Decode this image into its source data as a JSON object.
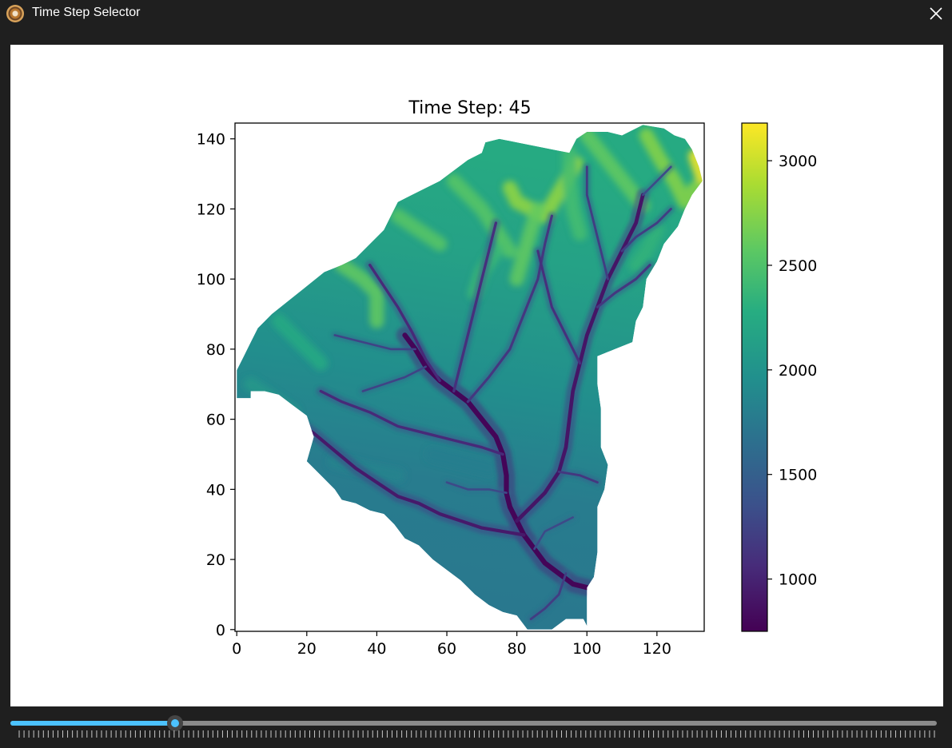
{
  "window": {
    "title": "Time Step Selector",
    "icon": "app-logo-icon",
    "close_icon": "close-icon"
  },
  "colors": {
    "window_bg": "#1f1f1f",
    "panel_bg": "#ffffff",
    "accent": "#4cc2ff",
    "slider_rail": "#8a8a8a"
  },
  "slider": {
    "value_fraction": 0.178,
    "tick_count": 190
  },
  "chart_data": {
    "type": "heatmap",
    "title": "Time Step: 45",
    "colormap": "viridis",
    "x": {
      "range": [
        -0.5,
        133.5
      ],
      "ticks": [
        0,
        20,
        40,
        60,
        80,
        100,
        120
      ]
    },
    "y": {
      "range": [
        -0.5,
        144.5
      ],
      "ticks": [
        0,
        20,
        40,
        60,
        80,
        100,
        120,
        140
      ]
    },
    "colorbar": {
      "range": [
        750,
        3180
      ],
      "ticks": [
        1000,
        1500,
        2000,
        2500,
        3000
      ]
    },
    "watershed_outline": [
      [
        0,
        66
      ],
      [
        4,
        66
      ],
      [
        4,
        68
      ],
      [
        8,
        68
      ],
      [
        12,
        67
      ],
      [
        16,
        64
      ],
      [
        20,
        61
      ],
      [
        22,
        55
      ],
      [
        20,
        48
      ],
      [
        24,
        44
      ],
      [
        28,
        40
      ],
      [
        30,
        37
      ],
      [
        34,
        36
      ],
      [
        38,
        34
      ],
      [
        42,
        33
      ],
      [
        45,
        30
      ],
      [
        48,
        26
      ],
      [
        52,
        24
      ],
      [
        56,
        20
      ],
      [
        60,
        17
      ],
      [
        64,
        14
      ],
      [
        68,
        10
      ],
      [
        72,
        7
      ],
      [
        76,
        5
      ],
      [
        80,
        4
      ],
      [
        83,
        0
      ],
      [
        90,
        0
      ],
      [
        94,
        3
      ],
      [
        99,
        3
      ],
      [
        100,
        1
      ],
      [
        100,
        12
      ],
      [
        102,
        15
      ],
      [
        103,
        22
      ],
      [
        103,
        35
      ],
      [
        105,
        40
      ],
      [
        106,
        47
      ],
      [
        104,
        52
      ],
      [
        104,
        63
      ],
      [
        103,
        70
      ],
      [
        103,
        78
      ],
      [
        108,
        80
      ],
      [
        113,
        82
      ],
      [
        114,
        88
      ],
      [
        116,
        92
      ],
      [
        117,
        100
      ],
      [
        120,
        105
      ],
      [
        122,
        110
      ],
      [
        126,
        115
      ],
      [
        128,
        120
      ],
      [
        130,
        124
      ],
      [
        133,
        128
      ],
      [
        132,
        132
      ],
      [
        130,
        137
      ],
      [
        128,
        140
      ],
      [
        125,
        141
      ],
      [
        122,
        143
      ],
      [
        116,
        144
      ],
      [
        110,
        141
      ],
      [
        106,
        142
      ],
      [
        100,
        142
      ],
      [
        97,
        140
      ],
      [
        95,
        136
      ],
      [
        90,
        137
      ],
      [
        85,
        138
      ],
      [
        80,
        139
      ],
      [
        75,
        140
      ],
      [
        71,
        139
      ],
      [
        70,
        136
      ],
      [
        66,
        134
      ],
      [
        62,
        131
      ],
      [
        58,
        128
      ],
      [
        54,
        126
      ],
      [
        50,
        124
      ],
      [
        46,
        122
      ],
      [
        44,
        118
      ],
      [
        42,
        114
      ],
      [
        38,
        110
      ],
      [
        34,
        106
      ],
      [
        30,
        104
      ],
      [
        25,
        102
      ],
      [
        20,
        98
      ],
      [
        15,
        94
      ],
      [
        10,
        90
      ],
      [
        6,
        86
      ],
      [
        4,
        82
      ],
      [
        2,
        78
      ],
      [
        0,
        74
      ]
    ],
    "ridges": [
      {
        "z": 3150,
        "pts": [
          [
            131,
            135
          ],
          [
            133,
            129
          ]
        ]
      },
      {
        "z": 2750,
        "pts": [
          [
            117,
            141
          ],
          [
            121,
            134
          ],
          [
            125,
            128
          ],
          [
            128,
            122
          ],
          [
            131,
            126
          ]
        ]
      },
      {
        "z": 2800,
        "pts": [
          [
            78,
            126
          ],
          [
            80,
            122
          ],
          [
            84,
            120
          ],
          [
            88,
            118
          ],
          [
            91,
            123
          ],
          [
            94,
            128
          ],
          [
            97,
            133
          ]
        ]
      },
      {
        "z": 2600,
        "pts": [
          [
            100,
            141
          ],
          [
            104,
            136
          ],
          [
            108,
            131
          ],
          [
            112,
            126
          ],
          [
            116,
            121
          ]
        ]
      },
      {
        "z": 2600,
        "pts": [
          [
            86,
            120
          ],
          [
            84,
            114
          ],
          [
            82,
            107
          ],
          [
            80,
            100
          ]
        ]
      },
      {
        "z": 2550,
        "pts": [
          [
            62,
            128
          ],
          [
            66,
            124
          ],
          [
            70,
            120
          ],
          [
            74,
            114
          ],
          [
            78,
            108
          ]
        ]
      },
      {
        "z": 2550,
        "pts": [
          [
            46,
            118
          ],
          [
            52,
            114
          ],
          [
            58,
            110
          ]
        ]
      },
      {
        "z": 2600,
        "pts": [
          [
            30,
            104
          ],
          [
            36,
            100
          ],
          [
            40,
            96
          ],
          [
            40,
            88
          ]
        ]
      },
      {
        "z": 2450,
        "pts": [
          [
            95,
            136
          ],
          [
            95,
            128
          ],
          [
            96,
            120
          ],
          [
            98,
            113
          ]
        ]
      },
      {
        "z": 2400,
        "pts": [
          [
            74,
            108
          ],
          [
            70,
            102
          ],
          [
            68,
            96
          ]
        ]
      },
      {
        "z": 2350,
        "pts": [
          [
            120,
            114
          ],
          [
            117,
            108
          ],
          [
            114,
            104
          ]
        ]
      },
      {
        "z": 2250,
        "pts": [
          [
            12,
            88
          ],
          [
            18,
            82
          ],
          [
            24,
            76
          ]
        ]
      },
      {
        "z": 2050,
        "pts": [
          [
            4,
            70
          ],
          [
            10,
            66
          ],
          [
            16,
            62
          ]
        ]
      },
      {
        "z": 1850,
        "pts": [
          [
            28,
            48
          ],
          [
            36,
            46
          ],
          [
            46,
            44
          ]
        ]
      },
      {
        "z": 1800,
        "pts": [
          [
            56,
            50
          ],
          [
            64,
            48
          ],
          [
            72,
            46
          ]
        ]
      }
    ],
    "rivers": [
      {
        "z": 780,
        "w": 2.4,
        "pts": [
          [
            100,
            12
          ],
          [
            96,
            13
          ],
          [
            92,
            16
          ],
          [
            88,
            19
          ],
          [
            85,
            23
          ],
          [
            82,
            27
          ],
          [
            80,
            31
          ],
          [
            78,
            35
          ],
          [
            77,
            39
          ],
          [
            77,
            44
          ],
          [
            76,
            50
          ],
          [
            74,
            55
          ],
          [
            70,
            60
          ],
          [
            66,
            65
          ],
          [
            62,
            68
          ],
          [
            58,
            71
          ],
          [
            54,
            75
          ],
          [
            51,
            80
          ],
          [
            48,
            84
          ]
        ]
      },
      {
        "z": 900,
        "w": 1.8,
        "pts": [
          [
            80,
            31
          ],
          [
            84,
            35
          ],
          [
            88,
            39
          ],
          [
            92,
            45
          ],
          [
            94,
            52
          ],
          [
            95,
            60
          ],
          [
            96,
            68
          ],
          [
            98,
            76
          ],
          [
            100,
            84
          ],
          [
            103,
            92
          ],
          [
            106,
            100
          ],
          [
            110,
            108
          ],
          [
            114,
            116
          ],
          [
            116,
            124
          ]
        ]
      },
      {
        "z": 930,
        "w": 1.6,
        "pts": [
          [
            82,
            27
          ],
          [
            76,
            28
          ],
          [
            70,
            29
          ],
          [
            64,
            31
          ],
          [
            58,
            33
          ],
          [
            52,
            36
          ],
          [
            46,
            38
          ],
          [
            40,
            42
          ],
          [
            34,
            46
          ],
          [
            28,
            51
          ],
          [
            22,
            56
          ],
          [
            16,
            60
          ]
        ]
      },
      {
        "z": 1050,
        "w": 1.3,
        "pts": [
          [
            76,
            50
          ],
          [
            70,
            52
          ],
          [
            62,
            54
          ],
          [
            54,
            56
          ],
          [
            46,
            58
          ],
          [
            38,
            62
          ],
          [
            30,
            65
          ],
          [
            24,
            68
          ]
        ]
      },
      {
        "z": 1050,
        "w": 1.3,
        "pts": [
          [
            58,
            71
          ],
          [
            54,
            77
          ],
          [
            50,
            85
          ],
          [
            46,
            92
          ],
          [
            42,
            98
          ],
          [
            38,
            104
          ]
        ]
      },
      {
        "z": 1100,
        "w": 1.3,
        "pts": [
          [
            62,
            68
          ],
          [
            64,
            76
          ],
          [
            66,
            84
          ],
          [
            68,
            92
          ],
          [
            70,
            100
          ],
          [
            72,
            108
          ],
          [
            74,
            116
          ]
        ]
      },
      {
        "z": 1150,
        "w": 1.2,
        "pts": [
          [
            66,
            65
          ],
          [
            72,
            72
          ],
          [
            78,
            80
          ],
          [
            82,
            90
          ],
          [
            86,
            100
          ],
          [
            88,
            110
          ],
          [
            90,
            118
          ]
        ]
      },
      {
        "z": 1100,
        "w": 1.2,
        "pts": [
          [
            98,
            76
          ],
          [
            94,
            84
          ],
          [
            90,
            92
          ],
          [
            88,
            100
          ],
          [
            86,
            108
          ]
        ]
      },
      {
        "z": 1150,
        "w": 1.2,
        "pts": [
          [
            103,
            92
          ],
          [
            108,
            96
          ],
          [
            114,
            100
          ],
          [
            118,
            104
          ]
        ]
      },
      {
        "z": 1200,
        "w": 1.1,
        "pts": [
          [
            106,
            100
          ],
          [
            104,
            108
          ],
          [
            102,
            116
          ],
          [
            100,
            124
          ],
          [
            100,
            132
          ]
        ]
      },
      {
        "z": 1200,
        "w": 1.1,
        "pts": [
          [
            110,
            108
          ],
          [
            114,
            112
          ],
          [
            120,
            116
          ],
          [
            124,
            120
          ]
        ]
      },
      {
        "z": 1150,
        "w": 1.1,
        "pts": [
          [
            92,
            45
          ],
          [
            98,
            44
          ],
          [
            103,
            42
          ]
        ]
      },
      {
        "z": 1200,
        "w": 1.1,
        "pts": [
          [
            94,
            16
          ],
          [
            92,
            10
          ],
          [
            88,
            6
          ],
          [
            84,
            3
          ]
        ]
      },
      {
        "z": 1250,
        "w": 1.0,
        "pts": [
          [
            51,
            80
          ],
          [
            44,
            80
          ],
          [
            36,
            82
          ],
          [
            28,
            84
          ]
        ]
      },
      {
        "z": 1250,
        "w": 1.0,
        "pts": [
          [
            54,
            75
          ],
          [
            48,
            72
          ],
          [
            42,
            70
          ],
          [
            36,
            68
          ]
        ]
      },
      {
        "z": 1300,
        "w": 1.0,
        "pts": [
          [
            85,
            23
          ],
          [
            88,
            28
          ],
          [
            92,
            30
          ],
          [
            96,
            32
          ]
        ]
      },
      {
        "z": 1300,
        "w": 1.0,
        "pts": [
          [
            77,
            39
          ],
          [
            72,
            40
          ],
          [
            66,
            40
          ],
          [
            60,
            42
          ]
        ]
      },
      {
        "z": 1300,
        "w": 1.0,
        "pts": [
          [
            116,
            124
          ],
          [
            120,
            128
          ],
          [
            124,
            132
          ]
        ]
      }
    ]
  }
}
